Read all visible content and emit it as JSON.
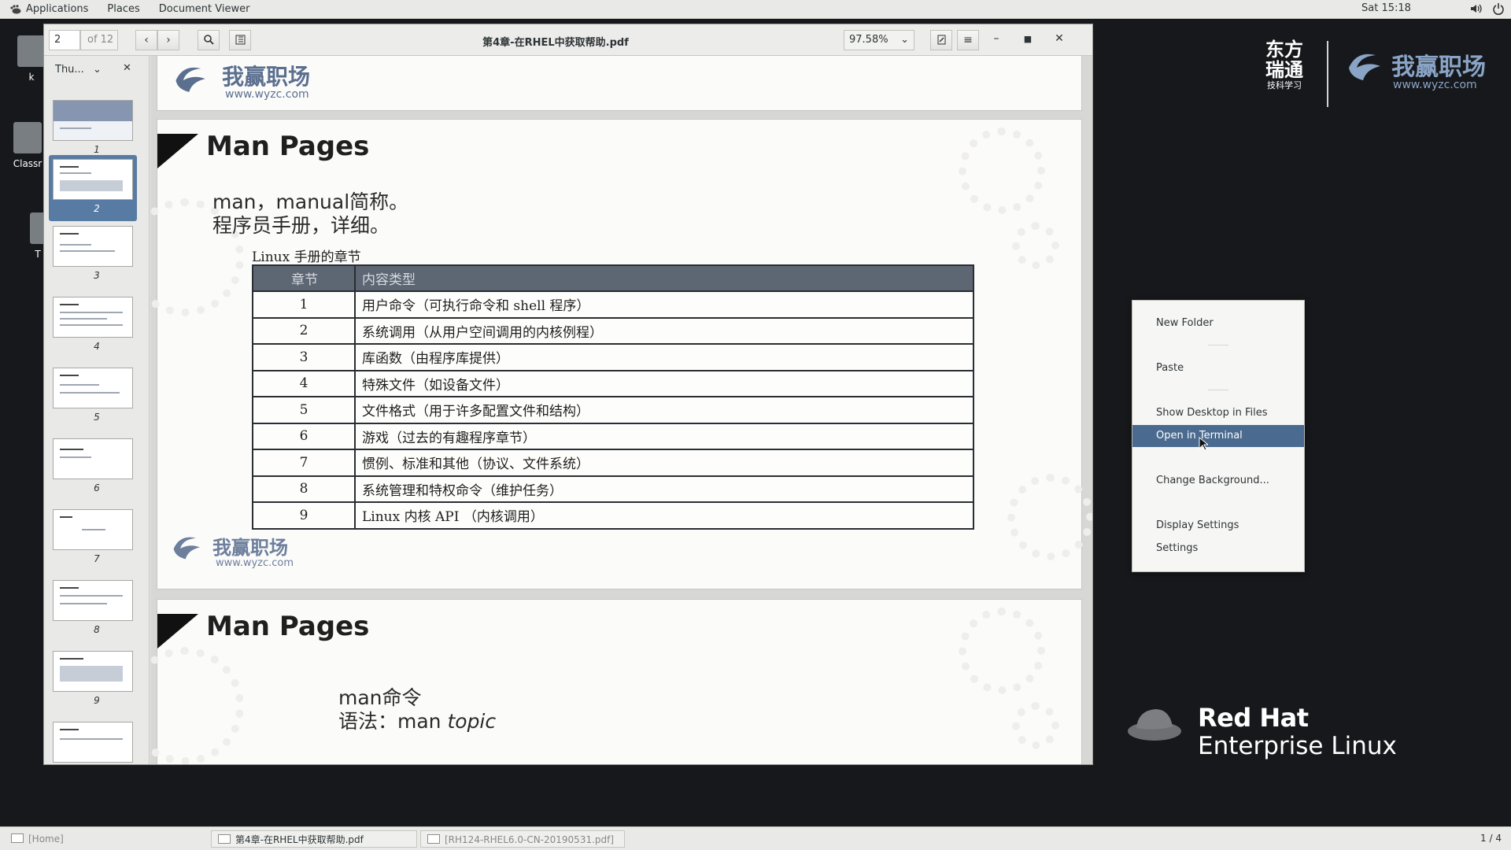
{
  "top_panel": {
    "applications": "Applications",
    "places": "Places",
    "document_viewer": "Document Viewer",
    "clock": "Sat 15:18"
  },
  "desktop": {
    "icon_classroom_label": "Classr",
    "icon_home_label": "k",
    "icon_trash_label": "T",
    "brand_dongfang": "东方瑞通",
    "brand_dongfang_sub": "技科学习",
    "brand_wyzc": "我赢职场",
    "brand_wyzc_url": "www.wyzc.com",
    "redhat_line1": "Red Hat",
    "redhat_line2": "Enterprise Linux"
  },
  "context_menu": {
    "items": [
      "New Folder",
      "Paste",
      "Show Desktop in Files",
      "Open in Terminal",
      "Change Background...",
      "Display Settings",
      "Settings"
    ],
    "active_index": 3
  },
  "viewer": {
    "page_current": "2",
    "page_total": "of 12",
    "title": "第4章-在RHEL中获取帮助.pdf",
    "zoom": "97.58%",
    "sidebar_mode": "Thu...",
    "thumbnails": [
      "1",
      "2",
      "3",
      "4",
      "5",
      "6",
      "7",
      "8",
      "9"
    ],
    "selected_thumbnail": "2"
  },
  "page2": {
    "header_logo": "我赢职场",
    "header_url": "www.wyzc.com",
    "title": "Man Pages",
    "line1": "man，manual简称。",
    "line2": "程序员手册，详细。",
    "table_caption": "Linux 手册的章节",
    "table_headers": [
      "章节",
      "内容类型"
    ],
    "rows": [
      {
        "num": "1",
        "desc": "用户命令（可执行命令和 shell 程序）"
      },
      {
        "num": "2",
        "desc": "系统调用（从用户空间调用的内核例程）"
      },
      {
        "num": "3",
        "desc": "库函数（由程序库提供）"
      },
      {
        "num": "4",
        "desc": "特殊文件（如设备文件）"
      },
      {
        "num": "5",
        "desc": "文件格式（用于许多配置文件和结构）"
      },
      {
        "num": "6",
        "desc": "游戏（过去的有趣程序章节）"
      },
      {
        "num": "7",
        "desc": "惯例、标准和其他（协议、文件系统）"
      },
      {
        "num": "8",
        "desc": "系统管理和特权命令（维护任务）"
      },
      {
        "num": "9",
        "desc": "Linux 内核 API （内核调用）"
      }
    ],
    "footer_logo": "我赢职场",
    "footer_url": "www.wyzc.com"
  },
  "page3": {
    "title": "Man Pages",
    "line1": "man命令",
    "line2_prefix": "语法：man ",
    "line2_topic": "topic"
  },
  "taskbar": {
    "home": "[Home]",
    "task1": "第4章-在RHEL中获取帮助.pdf",
    "task2": "[RH124-RHEL6.0-CN-20190531.pdf]",
    "workspace": "1 / 4"
  },
  "colors": {
    "menu_active": "#4a6a8f",
    "thumb_selected": "#587ba3",
    "table_header": "#5d6673",
    "desktop_bg": "#16181b"
  }
}
